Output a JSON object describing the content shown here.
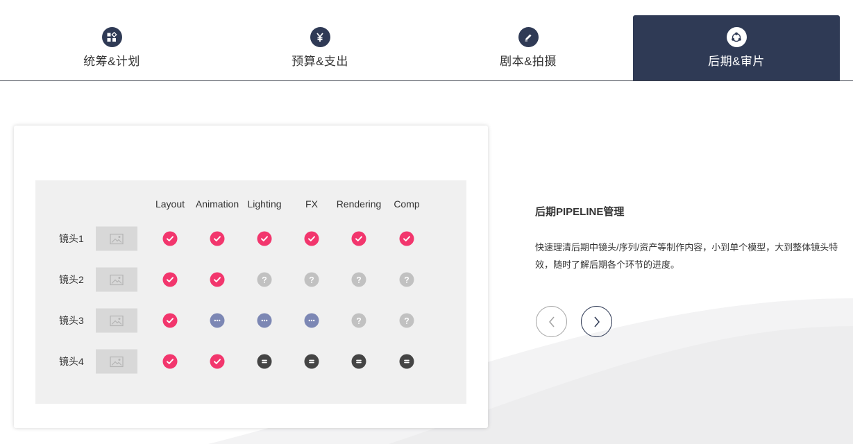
{
  "tabs": [
    {
      "label": "统筹&计划",
      "icon": "grid-diamond-icon",
      "active": false
    },
    {
      "label": "预算&支出",
      "icon": "yen-icon",
      "active": false
    },
    {
      "label": "剧本&拍摄",
      "icon": "pencil-icon",
      "active": false
    },
    {
      "label": "后期&审片",
      "icon": "share-nodes-icon",
      "active": true
    }
  ],
  "pipeline_table": {
    "columns": [
      "Layout",
      "Animation",
      "Lighting",
      "FX",
      "Rendering",
      "Comp"
    ],
    "rows": [
      {
        "label": "镜头1",
        "statuses": [
          "done",
          "done",
          "done",
          "done",
          "done",
          "done"
        ]
      },
      {
        "label": "镜头2",
        "statuses": [
          "done",
          "done",
          "unknown",
          "unknown",
          "unknown",
          "unknown"
        ]
      },
      {
        "label": "镜头3",
        "statuses": [
          "done",
          "in-progress",
          "in-progress",
          "in-progress",
          "unknown",
          "unknown"
        ]
      },
      {
        "label": "镜头4",
        "statuses": [
          "done",
          "done",
          "on-hold",
          "on-hold",
          "on-hold",
          "on-hold"
        ]
      }
    ],
    "status_colors": {
      "done": "#f2366d",
      "unknown": "#c1c1c1",
      "in-progress": "#7c87b4",
      "on-hold": "#444444"
    }
  },
  "info": {
    "title": "后期PIPELINE管理",
    "description": "快速理清后期中镜头/序列/资产等制作内容，小到单个模型，大到整体镜头特效，随时了解后期各个环节的进度。"
  },
  "nav": {
    "prev_icon": "chevron-left-icon",
    "next_icon": "chevron-right-icon"
  },
  "colors": {
    "accent": "#2f3a55",
    "done": "#f2366d"
  }
}
